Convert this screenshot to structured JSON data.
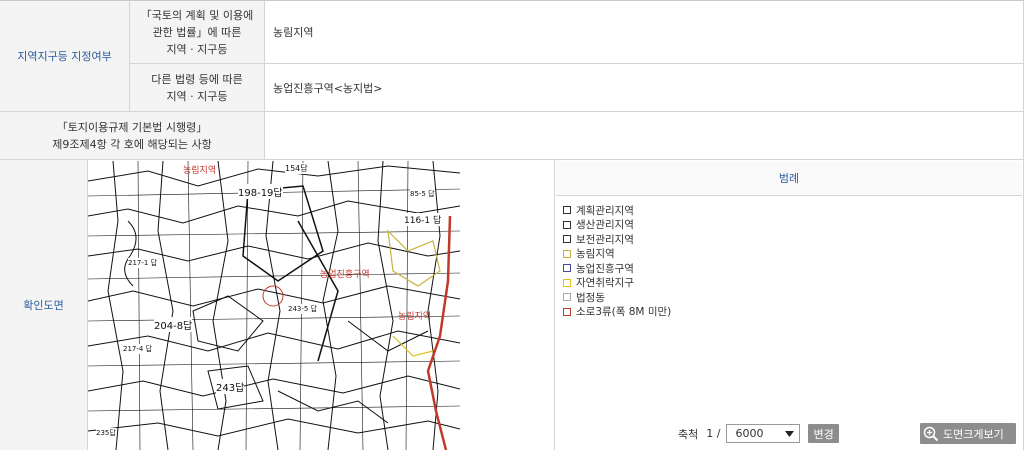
{
  "section": {
    "zoning_label": "지역지구등 지정여부",
    "law1_label_lines": [
      "「국토의 계획 및 이용에",
      "관한 법률」에 따른",
      "지역 · 지구등"
    ],
    "law1_value": "농림지역",
    "law2_label_lines": [
      "다른 법령 등에 따른",
      "지역 · 지구등"
    ],
    "law2_value": "농업진흥구역<농지법>",
    "decree_label_lines": [
      "「토지이용규제 기본법 시행령」",
      "제9조제4항 각 호에 해당되는 사항"
    ],
    "decree_value": ""
  },
  "map_section": {
    "label": "확인도면",
    "parcel_labels": [
      "154답",
      "198-19답",
      "116-1 답",
      "85-5 답",
      "204-8답",
      "243답",
      "217-1 답",
      "235답",
      "217-4 답",
      "243-5 답"
    ],
    "zone_labels": [
      "농림지역",
      "농업진흥구역",
      "농림지역"
    ]
  },
  "legend": {
    "title": "범례",
    "items": [
      {
        "label": "계획관리지역",
        "color": "#333333"
      },
      {
        "label": "생산관리지역",
        "color": "#333333"
      },
      {
        "label": "보전관리지역",
        "color": "#333333"
      },
      {
        "label": "농림지역",
        "color": "#c8b43c"
      },
      {
        "label": "농업진흥구역",
        "color": "#4a4aa0"
      },
      {
        "label": "자연취락지구",
        "color": "#e0c020"
      },
      {
        "label": "법정동",
        "color": "#aaaaaa"
      },
      {
        "label": "소로3류(폭 8M 미만)",
        "color": "#c0392b"
      }
    ]
  },
  "scale": {
    "label": "축척",
    "prefix": "1 /",
    "selected": "6000",
    "change_button": "변경"
  },
  "enlarge_button": "도면크게보기"
}
